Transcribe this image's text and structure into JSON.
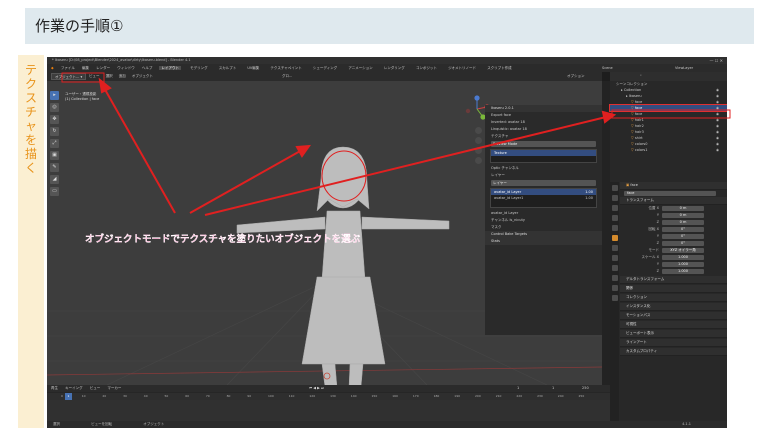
{
  "slide": {
    "title": "作業の手順①",
    "side_label": "テクスチャを描く",
    "annotation": "オブジェクトモードでテクスチャを塗りたいオブジェクトを選ぶ"
  },
  "window": {
    "title": "* Ikaseru [D:\\08_project\\Blender\\2024_avatar\\dirty\\Ikaseru.blend] - Blender 4.1",
    "controls": "—   ☐   ✕"
  },
  "menubar": {
    "items": [
      "ファイル",
      "編集",
      "レンダー",
      "ウィンドウ",
      "ヘルプ"
    ],
    "workspaces": [
      "レイアウト",
      "モデリング",
      "スカルプト",
      "UV編集",
      "テクスチャペイント",
      "シェーディング",
      "アニメーション",
      "レンダリング",
      "コンポジット",
      "ジオメトリノード",
      "スクリプト作成"
    ],
    "active_workspace": "レイアウト",
    "scene": "Scene",
    "view_layer": "ViewLayer"
  },
  "viewport_header": {
    "mode": "オブジェクト...",
    "items": [
      "ビュー",
      "選択",
      "追加",
      "オブジェクト"
    ],
    "transform": "グロ...",
    "options": "オプション"
  },
  "viewport": {
    "view_label": "ユーザー・透視投影",
    "collection_label": "(1) Collection | face",
    "tools": [
      "▸",
      "◎",
      "✥",
      "↻",
      "⤢",
      "▣",
      "✎",
      "◢",
      "▭"
    ]
  },
  "side_panel": {
    "header": "Ikaseru 2.0.1",
    "rows": [
      "Export face",
      "Inverted: avatar 18",
      "Linquistic: avatar 18",
      "テクスチャ",
      "Preview Mode",
      "Texture",
      "Optic チャンネル",
      "レイヤー",
      "avatar_id Layer1",
      "avatar_id Layer2",
      "avatar_id Layer",
      "チャンネル Is_nicuty",
      "マスク",
      "Control Bake Targets",
      "Stats"
    ],
    "preview_mode": "Preview Mode",
    "layers_label": "レイヤー",
    "layers": [
      {
        "name": "avatar_id Layer",
        "opacity": "1.00"
      },
      {
        "name": "avatar_id Layer1",
        "opacity": "1.00"
      }
    ]
  },
  "outliner": {
    "search_placeholder": "",
    "root": "シーンコレクション",
    "items": [
      {
        "name": "Collection",
        "indent": 1
      },
      {
        "name": "Ikaseru",
        "indent": 2
      },
      {
        "name": "face",
        "indent": 3
      },
      {
        "name": "face",
        "indent": 3
      },
      {
        "name": "face",
        "indent": 3
      },
      {
        "name": "hair1",
        "indent": 3
      },
      {
        "name": "hair2",
        "indent": 3
      },
      {
        "name": "hair3",
        "indent": 3
      },
      {
        "name": "shirt",
        "indent": 3
      },
      {
        "name": "colors0",
        "indent": 3
      },
      {
        "name": "colors1",
        "indent": 3
      }
    ],
    "selected_index": 3
  },
  "properties": {
    "object_name": "face",
    "object_name_field": "face",
    "transform_header": "トランスフォーム",
    "fields": [
      {
        "label": "位置 X",
        "value": "0 m"
      },
      {
        "label": "Y",
        "value": "0 m"
      },
      {
        "label": "Z",
        "value": "0 m"
      },
      {
        "label": "回転 X",
        "value": "0°"
      },
      {
        "label": "Y",
        "value": "0°"
      },
      {
        "label": "Z",
        "value": "0°"
      },
      {
        "label": "モード",
        "value": "XYZ オイラー角"
      },
      {
        "label": "スケール X",
        "value": "1.000"
      },
      {
        "label": "Y",
        "value": "1.000"
      },
      {
        "label": "Z",
        "value": "1.000"
      }
    ],
    "sections": [
      "デルタトランスフォーム",
      "関係",
      "コレクション",
      "インスタンス化",
      "モーションパス",
      "可視性",
      "ビューポート表示",
      "ラインアート",
      "カスタムプロパティ"
    ]
  },
  "timeline": {
    "header_items": [
      "再生",
      "キーイング",
      "ビュー",
      "マーカー"
    ],
    "current_frame": "1",
    "start": "1",
    "end": "250",
    "ticks": [
      "0",
      "10",
      "20",
      "30",
      "40",
      "50",
      "60",
      "70",
      "80",
      "90",
      "100",
      "110",
      "120",
      "130",
      "140",
      "150",
      "160",
      "170",
      "180",
      "190",
      "200",
      "210",
      "220",
      "230",
      "240",
      "250"
    ]
  },
  "status_bar": {
    "items": [
      "選択",
      "ビューを回転",
      "オブジェクト"
    ],
    "version": "4.1.1"
  }
}
